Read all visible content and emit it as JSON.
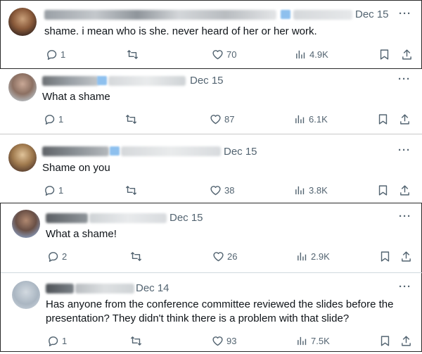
{
  "replies": [
    {
      "date": "Dec 15",
      "text": [
        "shame. i mean who is she. never heard of her or her work."
      ],
      "replies": "1",
      "likes": "70",
      "views": "4.9K"
    },
    {
      "date": "Dec 15",
      "text": [
        "What a shame"
      ],
      "replies": "1",
      "likes": "87",
      "views": "6.1K"
    },
    {
      "date": "Dec 15",
      "text": [
        "Shame on you"
      ],
      "replies": "1",
      "likes": "38",
      "views": "3.8K"
    },
    {
      "date": "Dec 15",
      "text": [
        "What a shame!"
      ],
      "replies": "2",
      "likes": "26",
      "views": "2.9K"
    },
    {
      "date": "Dec 14",
      "text": [
        "Has anyone from the conference committee reviewed the slides before the",
        "presentation? They didn't think there is a problem with that slide?"
      ],
      "replies": "1",
      "likes": "93",
      "views": "7.5K"
    }
  ],
  "icons": {
    "reply": "reply-icon",
    "repost": "repost-icon",
    "like": "like-icon",
    "views": "views-icon",
    "bookmark": "bookmark-icon",
    "share": "share-icon",
    "more": "more-icon"
  },
  "more_label": "···",
  "colors": {
    "secondary_text": "#536471",
    "primary_text": "#0f1419",
    "divider": "#cfd9de"
  }
}
